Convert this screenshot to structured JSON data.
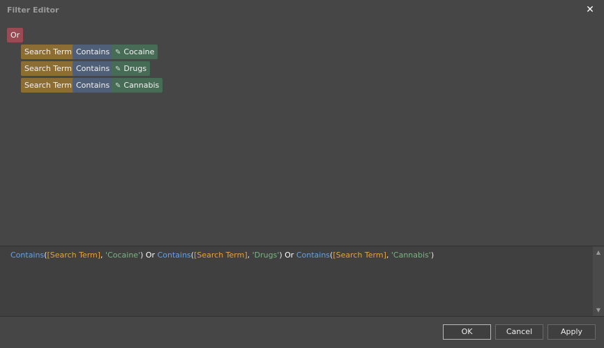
{
  "window": {
    "title": "Filter Editor",
    "close_icon": "close-icon"
  },
  "tree": {
    "group": "Or",
    "conditions": [
      {
        "field": "Search Term",
        "operator": "Contains",
        "value": "Cocaine"
      },
      {
        "field": "Search Term",
        "operator": "Contains",
        "value": "Drugs"
      },
      {
        "field": "Search Term",
        "operator": "Contains",
        "value": "Cannabis"
      }
    ]
  },
  "expression": {
    "tokens": [
      [
        "fn",
        "Contains"
      ],
      [
        "p",
        "("
      ],
      [
        "fld",
        "[Search Term]"
      ],
      [
        "p",
        ", "
      ],
      [
        "str",
        "'Cocaine'"
      ],
      [
        "p",
        ")"
      ],
      [
        "op",
        " Or "
      ],
      [
        "fn",
        "Contains"
      ],
      [
        "p",
        "("
      ],
      [
        "fld",
        "[Search Term]"
      ],
      [
        "p",
        ", "
      ],
      [
        "str",
        "'Drugs'"
      ],
      [
        "p",
        ")"
      ],
      [
        "op",
        " Or "
      ],
      [
        "fn",
        "Contains"
      ],
      [
        "p",
        "("
      ],
      [
        "fld",
        "[Search Term]"
      ],
      [
        "p",
        ", "
      ],
      [
        "str",
        "'Cannabis'"
      ],
      [
        "p",
        ")"
      ]
    ]
  },
  "buttons": {
    "ok": "OK",
    "cancel": "Cancel",
    "apply": "Apply"
  },
  "colors": {
    "group": "#9a4a53",
    "field": "#8c6d33",
    "operator": "#4f5f78",
    "value": "#466c55",
    "fn_text": "#6aa0e0",
    "field_text": "#e0a445",
    "string_text": "#7ab383"
  }
}
